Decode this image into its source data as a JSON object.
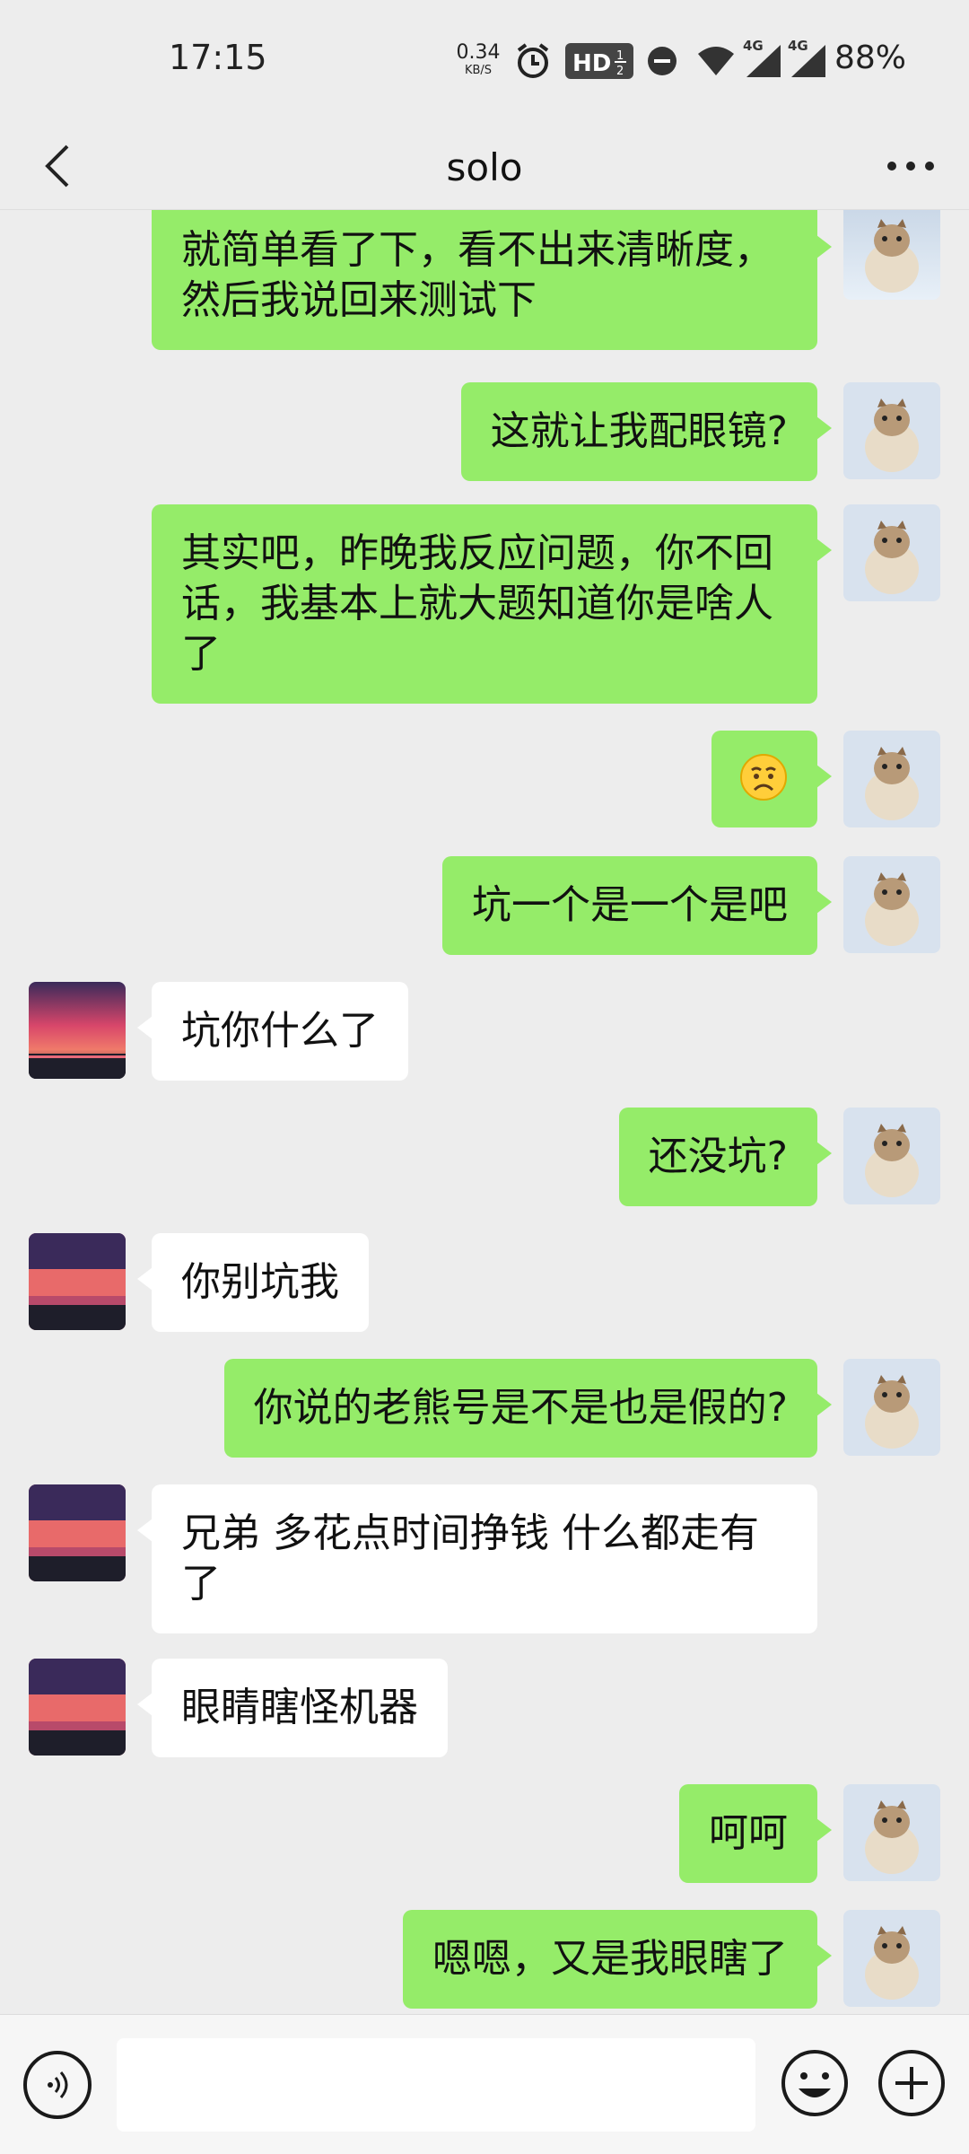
{
  "status_bar": {
    "time": "17:15",
    "net_speed": "0.34",
    "net_unit": "KB/S",
    "hd_label": "HD",
    "network_1": "4G",
    "network_2": "4G",
    "battery": "88%"
  },
  "header": {
    "title": "solo"
  },
  "messages": [
    {
      "sender": "self",
      "text": "就简单看了下，看不出来清晰度，\n然后我说回来测试下"
    },
    {
      "sender": "self",
      "text": "这就让我配眼镜?"
    },
    {
      "sender": "self",
      "text": "其实吧，昨晚我反应问题，你不回\n话，我基本上就大题知道你是啥人\n了"
    },
    {
      "sender": "self",
      "emoji": "frowning-face"
    },
    {
      "sender": "self",
      "text": "坑一个是一个是吧"
    },
    {
      "sender": "other",
      "text": "坑你什么了"
    },
    {
      "sender": "self",
      "text": "还没坑?"
    },
    {
      "sender": "other",
      "text": "你别坑我"
    },
    {
      "sender": "self",
      "text": "你说的老熊号是不是也是假的?"
    },
    {
      "sender": "other",
      "text": "兄弟 多花点时间挣钱 什么都走有\n了"
    },
    {
      "sender": "other",
      "text": "眼睛瞎怪机器"
    },
    {
      "sender": "self",
      "text": "呵呵"
    },
    {
      "sender": "self",
      "text": "嗯嗯，又是我眼瞎了"
    }
  ],
  "input_bar": {
    "placeholder": ""
  },
  "colors": {
    "self_bubble": "#95ec69",
    "other_bubble": "#ffffff",
    "background": "#ededed"
  },
  "icons": [
    "back-arrow-icon",
    "more-icon",
    "voice-icon",
    "emoji-icon",
    "plus-icon",
    "alarm-icon",
    "dnd-icon",
    "wifi-icon",
    "signal-icon"
  ]
}
